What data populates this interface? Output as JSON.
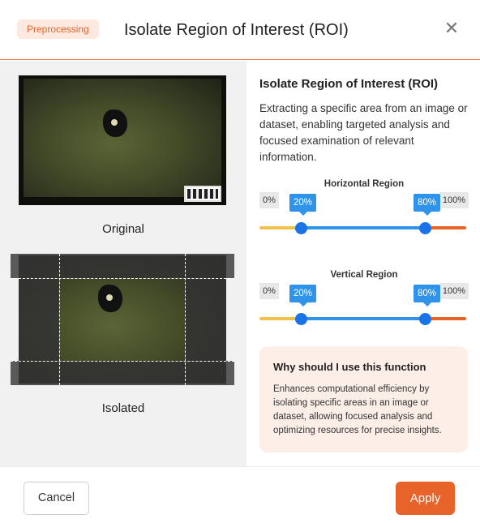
{
  "header": {
    "badge": "Preprocessing",
    "title": "Isolate Region of Interest (ROI)",
    "close_icon": "close-icon"
  },
  "preview": {
    "original_caption": "Original",
    "isolated_caption": "Isolated"
  },
  "info": {
    "title": "Isolate Region of Interest (ROI)",
    "description": "Extracting a specific area from an image or dataset, enabling targeted analysis and focused examination of relevant information."
  },
  "horizontal": {
    "label": "Horizontal Region",
    "min_label": "0%",
    "max_label": "100%",
    "low_value": "20%",
    "high_value": "80%",
    "low": 0.2,
    "high": 0.8
  },
  "vertical": {
    "label": "Vertical Region",
    "min_label": "0%",
    "max_label": "100%",
    "low_value": "20%",
    "high_value": "80%",
    "low": 0.2,
    "high": 0.8
  },
  "why": {
    "title": "Why should I use this function",
    "text": "Enhances computational efficiency by isolating specific areas in an image or dataset, allowing focused analysis and optimizing resources for precise insights."
  },
  "footer": {
    "cancel_label": "Cancel",
    "apply_label": "Apply"
  },
  "colors": {
    "accent": "#e8632a",
    "slider_blue": "#2f93ea",
    "thumb_blue": "#1a73e8",
    "track_low": "#f0c24a",
    "track_high": "#e8632a"
  }
}
